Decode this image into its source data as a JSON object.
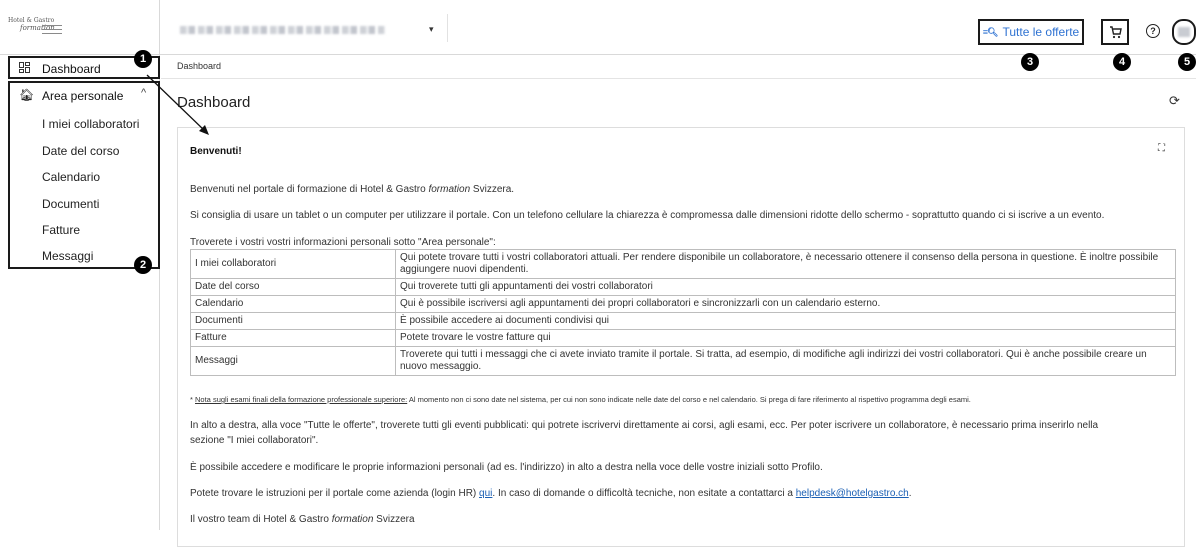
{
  "logo": {
    "line1": "Hotel & Gastro",
    "line2": "formation"
  },
  "header": {
    "offers_label": "Tutte le offerte",
    "company_caret": "▾"
  },
  "badges": [
    "1",
    "2",
    "3",
    "4",
    "5"
  ],
  "sidebar": {
    "dashboard_label": "Dashboard",
    "group_label": "Area personale",
    "items": [
      {
        "label": "I miei collaboratori"
      },
      {
        "label": "Date del corso"
      },
      {
        "label": "Calendario"
      },
      {
        "label": "Documenti"
      },
      {
        "label": "Fatture"
      },
      {
        "label": "Messaggi"
      }
    ]
  },
  "main": {
    "breadcrumb": "Dashboard",
    "title": "Dashboard",
    "card_title": "Benvenuti!",
    "p1_a": "Benvenuti nel portale di formazione di Hotel & Gastro ",
    "p1_b": "formation",
    "p1_c": " Svizzera.",
    "p2": "Si consiglia di usare un tablet o un computer per utilizzare il portale. Con un telefono cellulare la chiarezza è compromessa dalle dimensioni ridotte dello schermo - soprattutto quando ci si iscrive a un evento.",
    "p3": "Troverete i vostri vostri informazioni personali sotto \"Area personale\":",
    "table": [
      {
        "k": "I miei collaboratori",
        "v": "Qui potete trovare tutti i vostri collaboratori attuali. Per rendere disponibile un collaboratore, è necessario ottenere il consenso della persona in questione. È inoltre possibile aggiungere nuovi dipendenti."
      },
      {
        "k": "Date del corso",
        "v": "Qui troverete tutti gli appuntamenti dei vostri collaboratori"
      },
      {
        "k": "Calendario",
        "v": "Qui è possibile iscriversi agli appuntamenti dei propri collaboratori e sincronizzarli con un calendario esterno."
      },
      {
        "k": "Documenti",
        "v": "È possibile accedere ai documenti condivisi qui"
      },
      {
        "k": "Fatture",
        "v": "Potete trovare le vostre fatture qui"
      },
      {
        "k": "Messaggi",
        "v": "Troverete qui tutti i messaggi che ci avete inviato tramite il portale. Si tratta, ad esempio, di modifiche agli indirizzi dei vostri collaboratori. Qui è anche possibile creare un nuovo messaggio."
      }
    ],
    "note_link": "Nota sugli esami finali della formazione professionale superiore:",
    "note_text": " Al momento non ci sono date nel sistema, per cui non sono indicate nelle date del corso e nel calendario. Si prega di fare riferimento al rispettivo programma degli esami.",
    "p4a": "In alto a destra, alla voce \"Tutte le offerte\", troverete tutti gli eventi pubblicati: qui potrete iscrivervi direttamente ai corsi, agli esami, ecc. Per poter iscrivere un collaboratore, è necessario prima inserirlo nella",
    "p4b": "sezione \"I miei collaboratori\".",
    "p5": "È possibile accedere e modificare le proprie informazioni personali (ad es. l'indirizzo) in alto a destra nella voce delle vostre iniziali sotto Profilo.",
    "p6_a": "Potete trovare le istruzioni per il portale come azienda (login HR) ",
    "p6_link": "qui",
    "p6_b": ". In caso di domande o difficoltà tecniche, non esitate a contattarci a ",
    "p6_email": "helpdesk@hotelgastro.ch",
    "p6_c": ".",
    "p7_a": "Il vostro team di Hotel & Gastro ",
    "p7_b": "formation",
    "p7_c": " Svizzera"
  }
}
